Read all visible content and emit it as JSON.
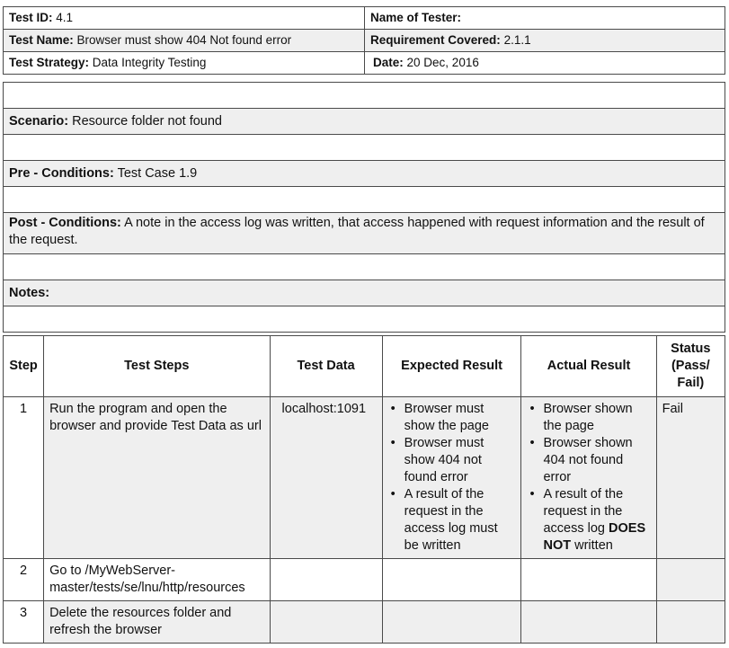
{
  "header": {
    "test_id_label": "Test ID:",
    "test_id": "4.1",
    "tester_label": "Name of Tester:",
    "tester": "",
    "test_name_label": "Test Name:",
    "test_name": "Browser must show 404 Not found error",
    "req_label": "Requirement Covered:",
    "req": "2.1.1",
    "strategy_label": "Test Strategy:",
    "strategy": "Data Integrity Testing",
    "date_label": "Date:",
    "date": "20 Dec, 2016"
  },
  "details": {
    "scenario_label": "Scenario:",
    "scenario": "Resource folder not found",
    "pre_label": "Pre - Conditions:",
    "pre": "Test Case 1.9",
    "post_label": "Post - Conditions:",
    "post": "A note in the access log was written, that access happened with request information and the result of the request.",
    "notes_label": "Notes:",
    "notes": ""
  },
  "steps": {
    "headers": {
      "step": "Step",
      "test_steps": "Test Steps",
      "test_data": "Test Data",
      "expected": "Expected Result",
      "actual": "Actual Result",
      "status": "Status (Pass/ Fail)"
    },
    "rows": [
      {
        "num": "1",
        "step": "Run the program and open the browser and provide Test Data as url",
        "data": "localhost:1091",
        "expected": [
          "Browser must show the page",
          "Browser must show 404 not found error",
          "A result of the request in the access log must be written"
        ],
        "actual": [
          "Browser shown the page",
          "Browser shown 404 not found error",
          "A result of the request in the access log"
        ],
        "actual_bold": "DOES NOT",
        "actual_tail": "written",
        "status": "Fail"
      },
      {
        "num": "2",
        "step": "Go to /MyWebServer-master/tests/se/lnu/http/resources",
        "data": "",
        "status": ""
      },
      {
        "num": "3",
        "step": "Delete the resources folder and refresh the browser",
        "data": "",
        "status": ""
      }
    ]
  }
}
